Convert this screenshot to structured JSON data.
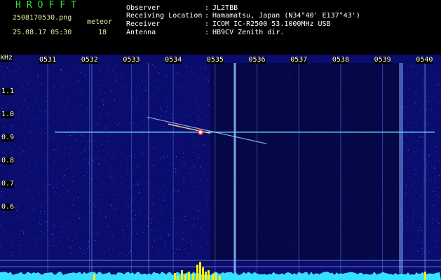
{
  "app": {
    "title": "HROFFT",
    "filename": "2508170530.png",
    "meteor_label": "meteor",
    "datetime": "25.08.17 05:30",
    "meteor_count": "18"
  },
  "station_info": [
    {
      "label": "Observer",
      "value": "JL2TBB"
    },
    {
      "label": "Receiving Location",
      "value": "Hamamatsu, Japan (N34°40' E137°43')"
    },
    {
      "label": "Receiver",
      "value": "ICOM IC-R2500 53.1000MHz USB"
    },
    {
      "label": "Antenna",
      "value": "HB9CV Zenith dir."
    }
  ],
  "spectrogram": {
    "y_unit": "kHz",
    "x_ticks": [
      "0531",
      "0532",
      "0533",
      "0534",
      "0535",
      "0536",
      "0537",
      "0538",
      "0539",
      "0540"
    ],
    "y_ticks": [
      "1.1",
      "1.0",
      "0.9",
      "0.8",
      "0.7",
      "0.6"
    ],
    "carrier_frequency_khz": 0.925,
    "background_color": "#0a0c6e",
    "carrier_color": "#66d8ff",
    "signal_bar_color": "#ffee00",
    "noise_floor_color": "#38e0ff"
  }
}
